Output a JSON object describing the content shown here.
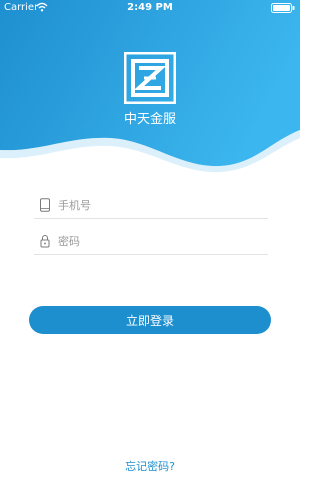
{
  "status_bar": {
    "carrier": "Carrier",
    "time": "2:49 PM"
  },
  "header": {
    "app_name": "中天金服",
    "gradient_colors": [
      "#1e8fd0",
      "#3cb6ee"
    ]
  },
  "form": {
    "phone_placeholder": "手机号",
    "password_placeholder": "密码",
    "phone_icon": "phone-icon",
    "lock_icon": "lock-icon"
  },
  "login_button": {
    "label": "立即登录",
    "color": "#1e8fce"
  },
  "forgot_password": {
    "label": "忘记密码?"
  }
}
